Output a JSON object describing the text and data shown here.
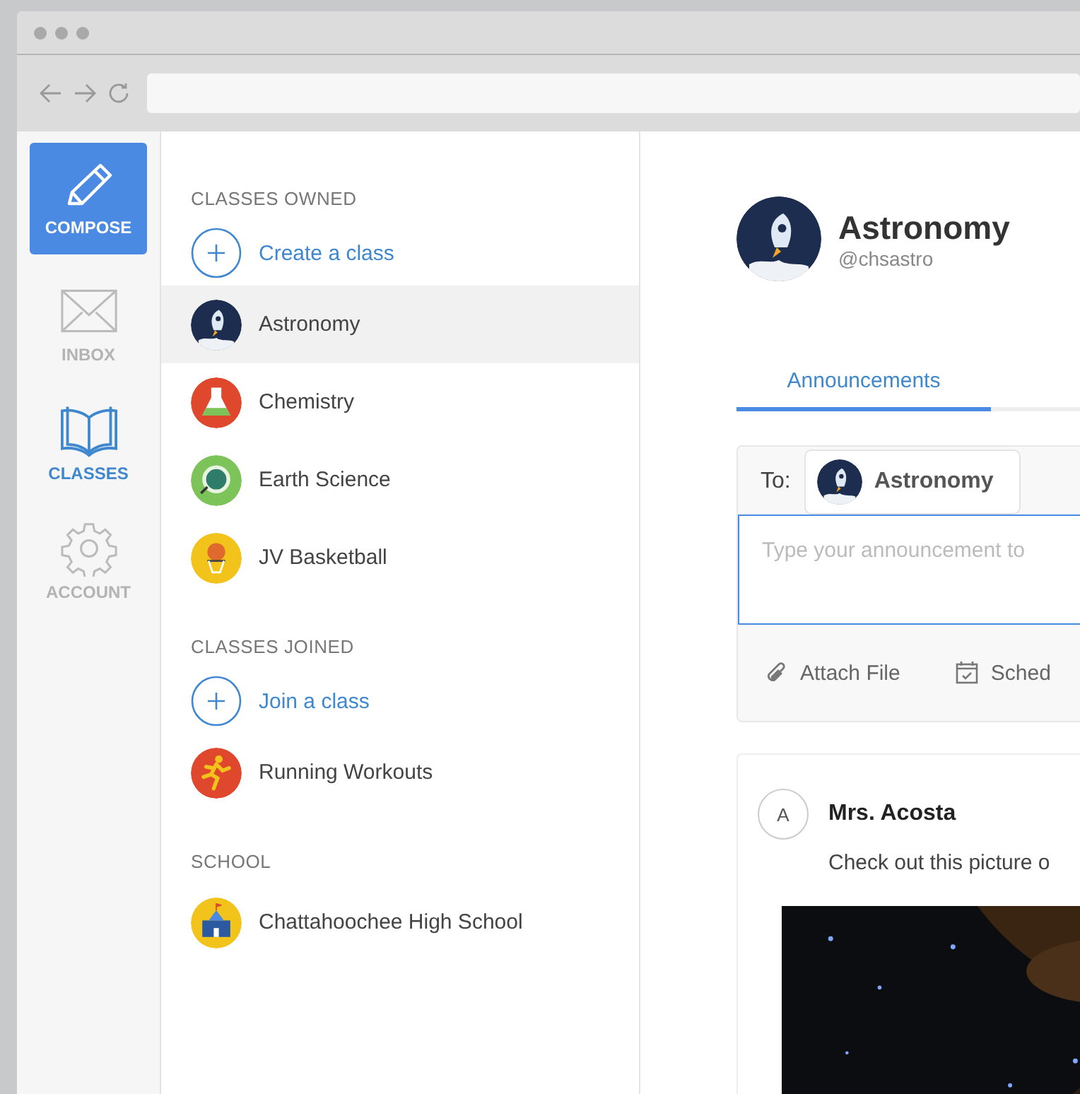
{
  "nav": {
    "compose": {
      "label": "COMPOSE"
    },
    "items": [
      {
        "kind": "inbox",
        "label": "INBOX",
        "selected": false
      },
      {
        "kind": "classes",
        "label": "CLASSES",
        "selected": true
      },
      {
        "kind": "account",
        "label": "ACCOUNT",
        "selected": false
      }
    ]
  },
  "class_sections": [
    {
      "heading": "CLASSES OWNED",
      "action": {
        "label": "Create a class"
      },
      "items": [
        {
          "name": "Astronomy",
          "kind": "rocket",
          "color": "#1d2d4f",
          "selected": true
        },
        {
          "name": "Chemistry",
          "kind": "flask",
          "color": "#e0482d",
          "selected": false
        },
        {
          "name": "Earth Science",
          "kind": "globe",
          "color": "#7cc35a",
          "selected": false
        },
        {
          "name": "JV Basketball",
          "kind": "basketball",
          "color": "#f2c31b",
          "selected": false
        }
      ]
    },
    {
      "heading": "CLASSES JOINED",
      "action": {
        "label": "Join a class"
      },
      "items": [
        {
          "name": "Running Workouts",
          "kind": "runner",
          "color": "#e0482d",
          "selected": false
        }
      ]
    },
    {
      "heading": "SCHOOL",
      "items": [
        {
          "name": "Chattahoochee High School",
          "kind": "school",
          "color": "#f2c31b",
          "selected": false
        }
      ]
    }
  ],
  "class_header": {
    "name": "Astronomy",
    "handle": "@chsastro"
  },
  "tabs": [
    {
      "label": "Announcements",
      "selected": true
    }
  ],
  "composer": {
    "to_label": "To:",
    "recipient": "Astronomy",
    "placeholder": "Type your announcement to",
    "actions": [
      {
        "kind": "attach",
        "label": "Attach File"
      },
      {
        "kind": "schedule",
        "label": "Sched"
      }
    ]
  },
  "post": {
    "initial": "A",
    "author": "Mrs. Acosta",
    "text": "Check out this picture o"
  }
}
